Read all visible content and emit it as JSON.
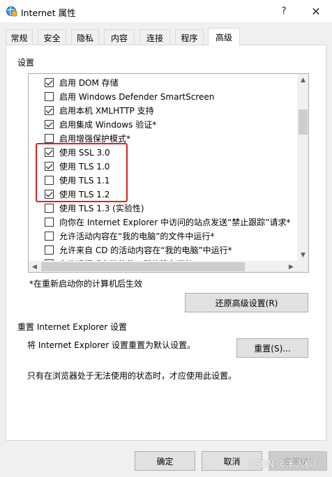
{
  "window": {
    "title": "Internet 属性",
    "help_glyph": "?",
    "close_glyph": "✕"
  },
  "tabs": [
    {
      "label": "常规"
    },
    {
      "label": "安全"
    },
    {
      "label": "隐私"
    },
    {
      "label": "内容"
    },
    {
      "label": "连接"
    },
    {
      "label": "程序"
    },
    {
      "label": "高级",
      "active": true
    }
  ],
  "settings": {
    "group_label": "设置",
    "items": [
      {
        "label": "启用 DOM 存储",
        "checked": true
      },
      {
        "label": "启用 Windows Defender SmartScreen",
        "checked": false
      },
      {
        "label": "启用本机 XMLHTTP 支持",
        "checked": true
      },
      {
        "label": "启用集成 Windows 验证*",
        "checked": true
      },
      {
        "label": "启用增强保护模式*",
        "checked": false
      },
      {
        "label": "使用 SSL 3.0",
        "checked": true
      },
      {
        "label": "使用 TLS 1.0",
        "checked": true
      },
      {
        "label": "使用 TLS 1.1",
        "checked": false
      },
      {
        "label": "使用 TLS 1.2",
        "checked": true
      },
      {
        "label": "使用 TLS 1.3 (实验性)",
        "checked": false
      },
      {
        "label": "向你在 Internet Explorer 中访问的站点发送“禁止跟踪”请求*",
        "checked": false
      },
      {
        "label": "允许活动内容在“我的电脑”的文件中运行*",
        "checked": false
      },
      {
        "label": "允许来自 CD 的活动内容在“我的电脑”中运行*",
        "checked": false
      },
      {
        "label": "允许运行或安装软件，即使签名无效",
        "checked": false
      }
    ],
    "restart_note": "*在重新启动你的计算机后生效",
    "restore_button": "还原高级设置(R)"
  },
  "reset": {
    "group_title": "重置 Internet Explorer 设置",
    "description": "将 Internet Explorer 设置重置为默认设置。",
    "button": "重置(S)...",
    "note": "只有在浏览器处于无法使用的状态时，才应使用此设置。"
  },
  "footer": {
    "ok": "确定",
    "cancel": "取消",
    "apply": "应用(A)"
  },
  "watermark": "CSDN @禾入枫i",
  "colors": {
    "highlight_box": "#e02020",
    "window_bg": "#f0f0f0",
    "page_bg": "#ffffff"
  }
}
